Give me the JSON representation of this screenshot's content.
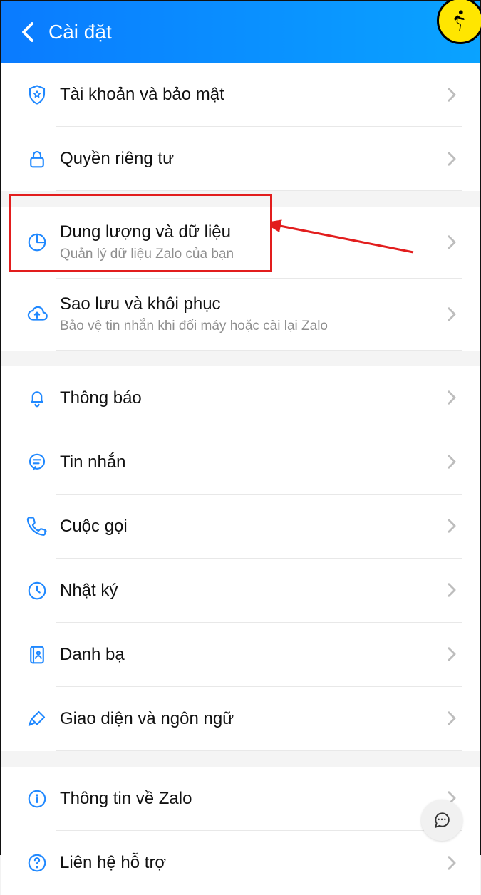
{
  "header": {
    "title": "Cài đặt"
  },
  "sections": [
    {
      "rows": [
        {
          "id": "account-security",
          "icon": "shield-star",
          "label": "Tài khoản và bảo mật"
        },
        {
          "id": "privacy",
          "icon": "lock",
          "label": "Quyền riêng tư"
        }
      ]
    },
    {
      "rows": [
        {
          "id": "storage-data",
          "icon": "pie",
          "label": "Dung lượng và dữ liệu",
          "sub": "Quản lý dữ liệu Zalo của bạn"
        },
        {
          "id": "backup-restore",
          "icon": "cloud-up",
          "label": "Sao lưu và khôi phục",
          "sub": "Bảo vệ tin nhắn khi đổi máy hoặc cài lại Zalo"
        }
      ]
    },
    {
      "rows": [
        {
          "id": "notifications",
          "icon": "bell",
          "label": "Thông báo"
        },
        {
          "id": "messages",
          "icon": "message",
          "label": "Tin nhắn"
        },
        {
          "id": "calls",
          "icon": "phone",
          "label": "Cuộc gọi"
        },
        {
          "id": "timeline",
          "icon": "clock",
          "label": "Nhật ký"
        },
        {
          "id": "contacts",
          "icon": "book",
          "label": "Danh bạ"
        },
        {
          "id": "ui-language",
          "icon": "brush",
          "label": "Giao diện và ngôn ngữ"
        }
      ]
    },
    {
      "rows": [
        {
          "id": "about",
          "icon": "info",
          "label": "Thông tin về Zalo"
        },
        {
          "id": "support",
          "icon": "question",
          "label": "Liên hệ hỗ trợ"
        }
      ]
    }
  ],
  "annotation": {
    "highlighted_row_id": "storage-data"
  }
}
